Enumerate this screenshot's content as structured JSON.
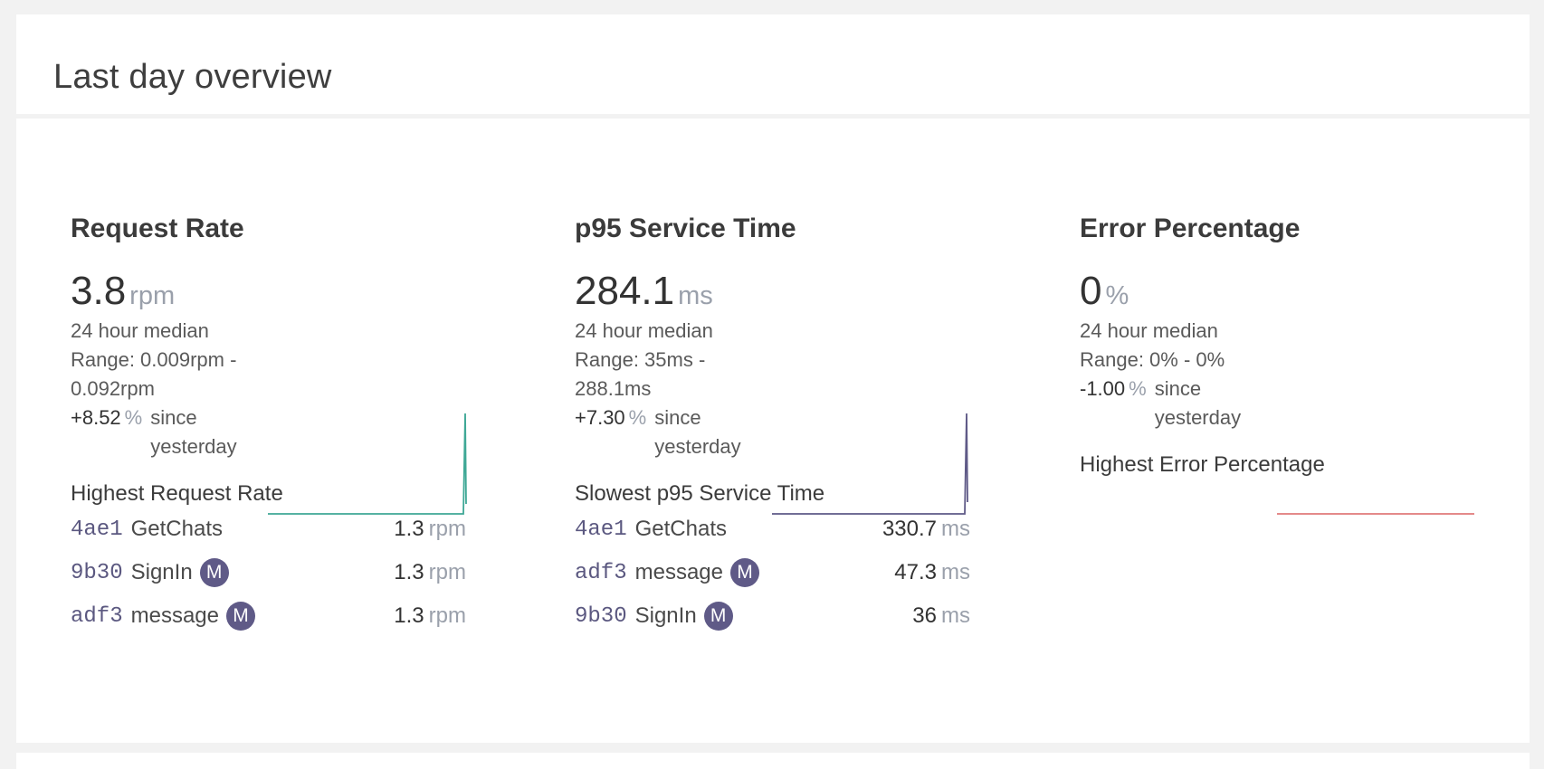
{
  "header": {
    "title": "Last day overview"
  },
  "colors": {
    "request_line": "#3fa896",
    "service_line": "#5f5a87",
    "error_line": "#e07a7a",
    "badge": "#5f5a87"
  },
  "metrics": [
    {
      "title": "Request Rate",
      "value": "3.8",
      "unit": "rpm",
      "median_label": "24 hour median",
      "range_line1": "Range: 0.009rpm -",
      "range_line2": "0.092rpm",
      "change_value": "+8.52",
      "change_unit": "%",
      "since_line1": "since",
      "since_line2": "yesterday",
      "list_title": "Highest Request Rate",
      "list": [
        {
          "hash": "4ae1",
          "name": "GetChats",
          "badge": "",
          "value": "1.3",
          "unit": "rpm"
        },
        {
          "hash": "9b30",
          "name": "SignIn",
          "badge": "M",
          "value": "1.3",
          "unit": "rpm"
        },
        {
          "hash": "adf3",
          "name": "message",
          "badge": "M",
          "value": "1.3",
          "unit": "rpm"
        }
      ]
    },
    {
      "title": "p95 Service Time",
      "value": "284.1",
      "unit": "ms",
      "median_label": "24 hour median",
      "range_line1": "Range: 35ms -",
      "range_line2": "288.1ms",
      "change_value": "+7.30",
      "change_unit": "%",
      "since_line1": "since",
      "since_line2": "yesterday",
      "list_title": "Slowest p95 Service Time",
      "list": [
        {
          "hash": "4ae1",
          "name": "GetChats",
          "badge": "",
          "value": "330.7",
          "unit": "ms"
        },
        {
          "hash": "adf3",
          "name": "message",
          "badge": "M",
          "value": "47.3",
          "unit": "ms"
        },
        {
          "hash": "9b30",
          "name": "SignIn",
          "badge": "M",
          "value": "36",
          "unit": "ms"
        }
      ]
    },
    {
      "title": "Error Percentage",
      "value": "0",
      "unit": "%",
      "median_label": "24 hour median",
      "range_line1": "Range: 0% - 0%",
      "range_line2": "",
      "change_value": "-1.00",
      "change_unit": "%",
      "since_line1": "since",
      "since_line2": "yesterday",
      "list_title": "Highest Error Percentage",
      "list": []
    }
  ]
}
